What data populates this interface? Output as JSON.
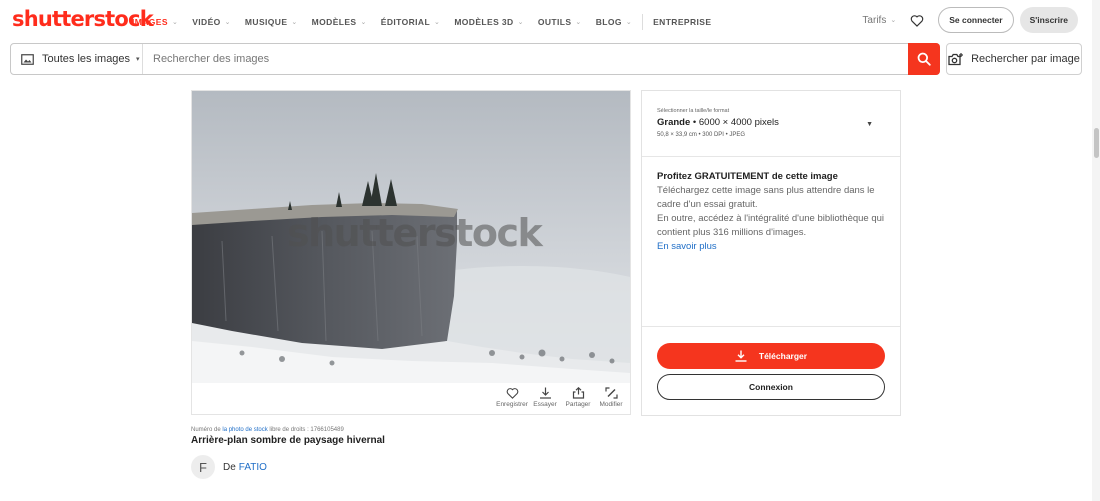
{
  "brand": {
    "logo_text": "shutterstock",
    "accent": "#ff2c1c"
  },
  "nav": {
    "items": [
      {
        "label": "IMAGES",
        "active": true,
        "has_menu": true
      },
      {
        "label": "VIDÉO",
        "active": false,
        "has_menu": true
      },
      {
        "label": "MUSIQUE",
        "active": false,
        "has_menu": true
      },
      {
        "label": "MODÈLES",
        "active": false,
        "has_menu": true
      },
      {
        "label": "ÉDITORIAL",
        "active": false,
        "has_menu": true
      },
      {
        "label": "MODÈLES 3D",
        "active": false,
        "has_menu": true
      },
      {
        "label": "OUTILS",
        "active": false,
        "has_menu": true
      },
      {
        "label": "BLOG",
        "active": false,
        "has_menu": true
      }
    ],
    "enterprise": "ENTREPRISE",
    "tarifs": "Tarifs",
    "login": "Se connecter",
    "signup": "S'inscrire"
  },
  "search": {
    "filter_label": "Toutes les images",
    "placeholder": "Rechercher des images",
    "reverse_label": "Rechercher par image"
  },
  "image": {
    "watermark": "shutterstock",
    "actions": [
      {
        "label": "Enregistrer",
        "icon": "heart-icon"
      },
      {
        "label": "Essayer",
        "icon": "download-icon"
      },
      {
        "label": "Partager",
        "icon": "share-icon"
      },
      {
        "label": "Modifier",
        "icon": "edit-icon"
      }
    ],
    "stock_prefix": "Numéro de",
    "stock_link": "la photo de stock",
    "stock_suffix": "libre de droits : 1766105489",
    "title": "Arrière-plan sombre de paysage hivernal",
    "author_initial": "F",
    "author_prefix": "De",
    "author_name": "FATIO"
  },
  "panel": {
    "size_label": "Sélectionner la taille/le format",
    "size_name": "Grande",
    "size_dims": "• 6000 × 4000 pixels",
    "size_details": "50,8 × 33,9 cm • 300 DPI • JPEG",
    "promo_title": "Profitez GRATUITEMENT de cette image",
    "promo_text": "Téléchargez cette image sans plus attendre dans le cadre d'un essai gratuit.",
    "promo_text2": "En outre, accédez à l'intégralité d'une bibliothèque qui contient plus 316 millions d'images.",
    "promo_link": "En savoir plus",
    "download_label": "Télécharger",
    "login_label": "Connexion"
  }
}
